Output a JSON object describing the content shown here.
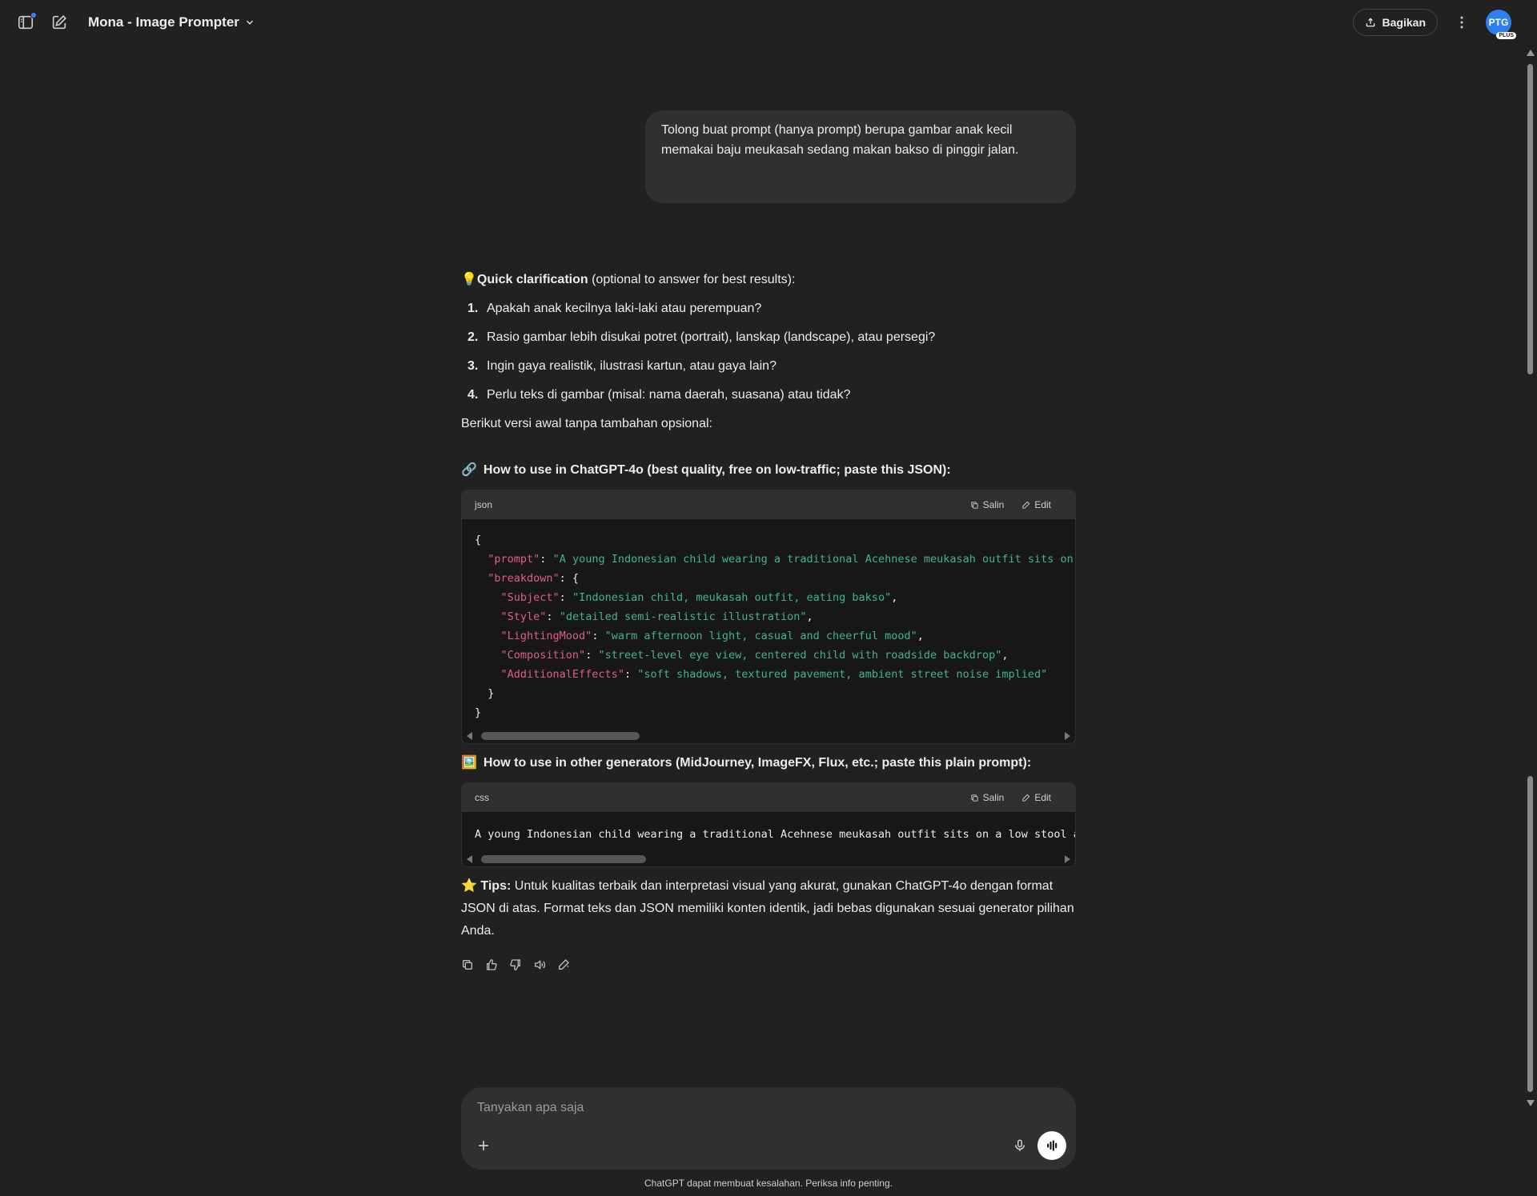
{
  "header": {
    "title": "Mona - Image Prompter",
    "share_label": "Bagikan",
    "avatar_initials": "PTG",
    "avatar_badge": "PLUS"
  },
  "user_message": "Tolong buat prompt (hanya prompt) berupa gambar anak kecil memakai baju meukasah sedang makan bakso di pinggir jalan.",
  "assistant": {
    "clarify_emoji": "💡",
    "clarify_bold": "Quick clarification",
    "clarify_rest": " (optional to answer for best results):",
    "questions": [
      {
        "num": "1.",
        "text": "Apakah anak kecilnya laki-laki atau perempuan?"
      },
      {
        "num": "2.",
        "text": "Rasio gambar lebih disukai potret (portrait), lanskap (landscape), atau persegi?"
      },
      {
        "num": "3.",
        "text": "Ingin gaya realistik, ilustrasi kartun, atau gaya lain?"
      },
      {
        "num": "4.",
        "text": "Perlu teks di gambar (misal: nama daerah, suasana) atau tidak?"
      }
    ],
    "intro": "Berikut versi awal tanpa tambahan opsional:",
    "section1_emoji": "🔗",
    "section1": "How to use in ChatGPT-4o (best quality, free on low-traffic; paste this JSON):",
    "code1": {
      "lang": "json",
      "copy_label": "Salin",
      "edit_label": "Edit",
      "prompt_value": "\"A young Indonesian child wearing a traditional Acehnese meukasah outfit sits on a low",
      "breakdown": [
        {
          "key": "\"Subject\"",
          "value": "\"Indonesian child, meukasah outfit, eating bakso\"",
          "comma": ","
        },
        {
          "key": "\"Style\"",
          "value": "\"detailed semi-realistic illustration\"",
          "comma": ","
        },
        {
          "key": "\"LightingMood\"",
          "value": "\"warm afternoon light, casual and cheerful mood\"",
          "comma": ","
        },
        {
          "key": "\"Composition\"",
          "value": "\"street-level eye view, centered child with roadside backdrop\"",
          "comma": ","
        },
        {
          "key": "\"AdditionalEffects\"",
          "value": "\"soft shadows, textured pavement, ambient street noise implied\"",
          "comma": ""
        }
      ]
    },
    "section2_emoji": "🖼️",
    "section2": "How to use in other generators (MidJourney, ImageFX, Flux, etc.; paste this plain prompt):",
    "code2": {
      "lang": "css",
      "copy_label": "Salin",
      "edit_label": "Edit",
      "text": "A young Indonesian child wearing a traditional Acehnese meukasah outfit sits on a low stool at a l"
    },
    "tips_emoji": "⭐",
    "tips_bold": "Tips:",
    "tips_rest": " Untuk kualitas terbaik dan interpretasi visual yang akurat, gunakan ChatGPT-4o dengan format JSON di atas. Format teks dan JSON memiliki konten identik, jadi bebas digunakan sesuai generator pilihan Anda."
  },
  "composer": {
    "placeholder": "Tanyakan apa saja"
  },
  "footer_note": "ChatGPT dapat membuat kesalahan. Periksa info penting.",
  "colors": {
    "background": "#212121",
    "bubble": "#303030",
    "json_key": "#e05d87",
    "json_string": "#3fb68b",
    "accent": "#2f80ed"
  },
  "icons": [
    "sidebar-toggle-icon",
    "new-chat-icon",
    "chevron-down-icon",
    "share-icon",
    "more-vertical-icon",
    "copy-icon",
    "edit-icon",
    "thumbs-up-icon",
    "thumbs-down-icon",
    "speaker-icon",
    "edit-pen-icon",
    "plus-icon",
    "mic-icon",
    "voice-mode-icon"
  ]
}
